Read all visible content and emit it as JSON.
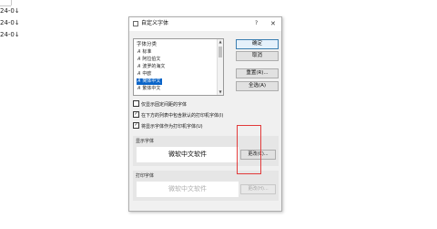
{
  "document": {
    "lines": [
      "24-0↓",
      "24-0↓",
      "24-0↓"
    ]
  },
  "dialog": {
    "title": "自定义字体",
    "help": "?",
    "close": "✕",
    "list": {
      "header": "字体分类",
      "items": [
        {
          "label": "标准",
          "selected": false
        },
        {
          "label": "阿拉伯文",
          "selected": false
        },
        {
          "label": "波罗的海文",
          "selected": false
        },
        {
          "label": "中欧",
          "selected": false
        },
        {
          "label": "简体中文",
          "selected": true
        },
        {
          "label": "繁体中文",
          "selected": false
        }
      ]
    },
    "buttons": {
      "ok": "确定",
      "cancel": "取消",
      "reset": "重置(R)...",
      "reset_all": "全选(A)"
    },
    "checks": [
      {
        "label": "仅显示固定间距的字体",
        "checked": false
      },
      {
        "label": "在下方的列表中包含默认的打印机字体(I)",
        "checked": true
      },
      {
        "label": "将显示字体作为打印机字体(U)",
        "checked": true
      }
    ],
    "display_font": {
      "label": "显示字体",
      "preview": "微软中文软件",
      "change": "更改(C)..."
    },
    "printer_font": {
      "label": "打印字体",
      "preview": "微软中文软件",
      "change": "更改(H)..."
    }
  },
  "colors": {
    "selection": "#0a64c8",
    "highlight_box": "#e23b3b"
  }
}
